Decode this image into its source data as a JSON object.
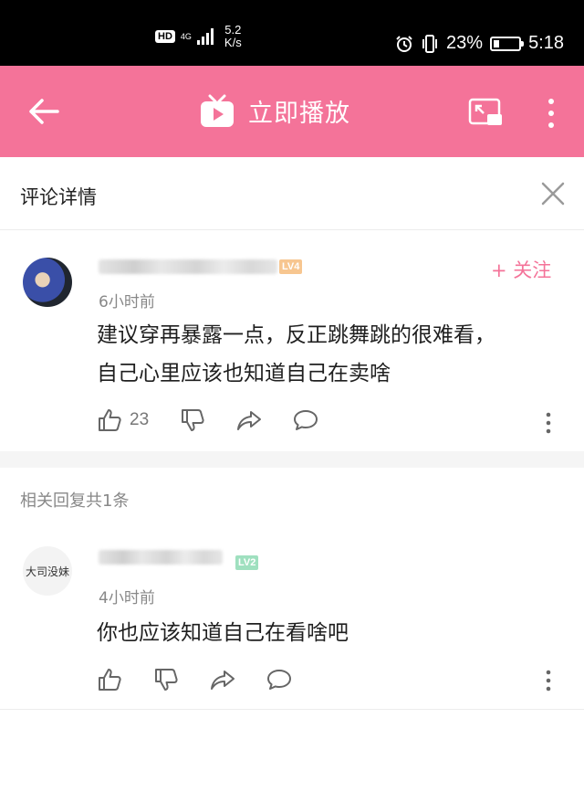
{
  "status_bar": {
    "hd": "HD",
    "network": "4G",
    "speed_value": "5.2",
    "speed_unit": "K/s",
    "battery": "23%",
    "battery_level": 0.23,
    "time": "5:18"
  },
  "app_bar": {
    "title": "立即播放",
    "accent_color": "#f47399"
  },
  "detail": {
    "title": "评论详情"
  },
  "main_comment": {
    "level": "LV4",
    "time": "6小时前",
    "follow_label": "+ 关注",
    "text_line1": "建议穿再暴露一点，反正跳舞跳的很难看，",
    "text_line2": "自己心里应该也知道自己在卖啥",
    "like_count": "23"
  },
  "replies": {
    "header": "相关回复共1条",
    "items": [
      {
        "avatar_text": "大司没妹",
        "level": "LV2",
        "time": "4小时前",
        "text": "你也应该知道自己在看啥吧"
      }
    ]
  }
}
